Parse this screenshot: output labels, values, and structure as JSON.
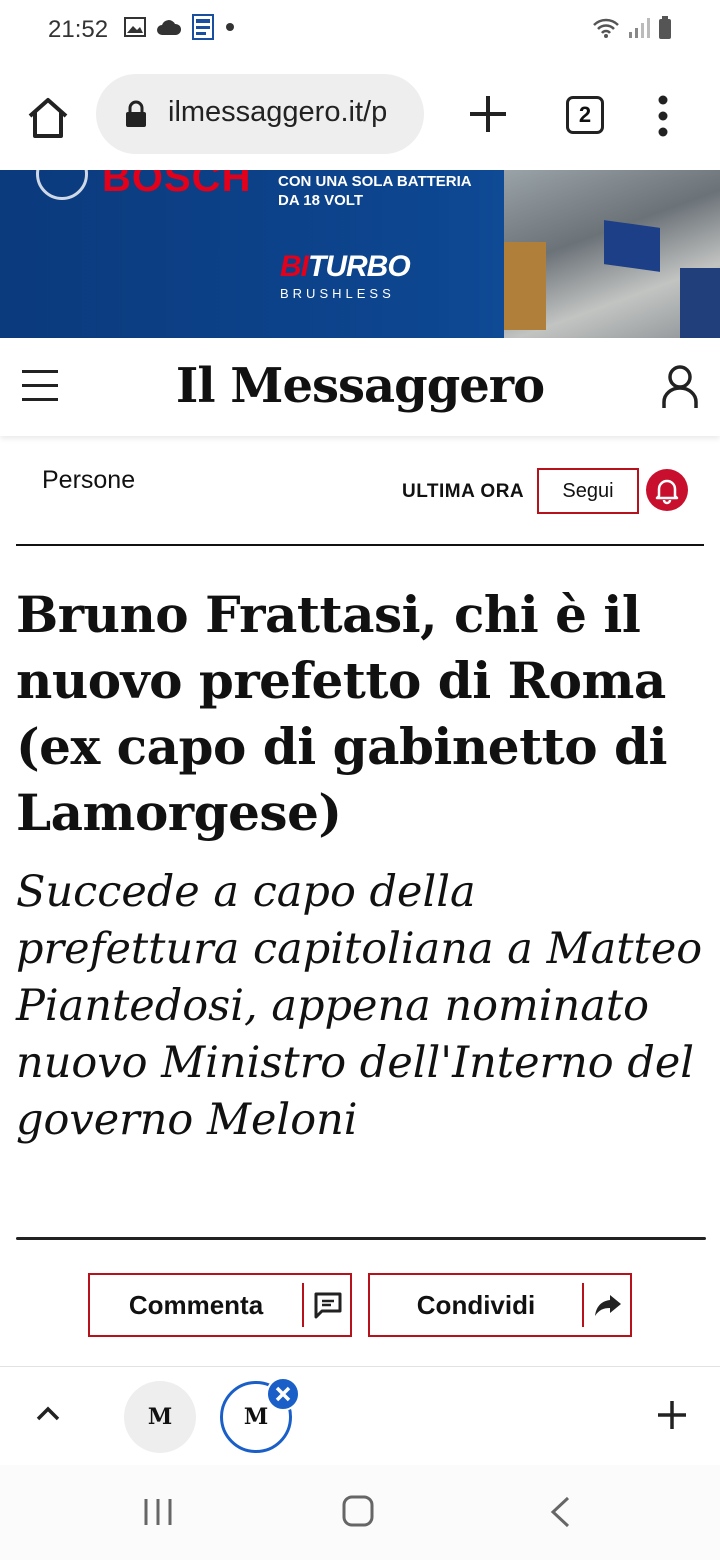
{
  "status_bar": {
    "time": "21:52",
    "left_icons": [
      "image-icon",
      "cloud-icon",
      "document-icon",
      "dot-icon"
    ],
    "right_icons": [
      "wifi-icon",
      "signal-icon",
      "battery-icon"
    ]
  },
  "browser": {
    "url": "ilmessaggero.it/p",
    "tab_count": "2",
    "icons": [
      "home-icon",
      "lock-icon",
      "new-tab-icon",
      "tabs-icon",
      "menu-icon"
    ]
  },
  "ad": {
    "brand": "BOSCH",
    "line1": "CON UNA SOLA BATTERIA",
    "line2": "DA 18 VOLT",
    "product_bi": "BI",
    "product_rest": "TURBO",
    "subtitle": "BRUSHLESS",
    "colors": {
      "background": "#0d4690",
      "accent": "#e2001a"
    }
  },
  "site_header": {
    "masthead": "Il Messaggero"
  },
  "section": {
    "label": "Persone",
    "ultima_ora": "ULTIMA ORA",
    "follow_label": "Segui"
  },
  "article": {
    "headline": "Bruno Frattasi, chi è il nuovo prefetto di Roma (ex capo di gabinetto di Lamorgese)",
    "subheadline": "Succede a capo della prefettura capitoliana a Matteo Piantedosi, appena nominato nuovo Ministro dell'Interno del governo Meloni"
  },
  "actions": {
    "comment_label": "Commenta",
    "share_label": "Condividi",
    "accent": "#b5121b"
  },
  "tab_strip": {
    "tab_logo": "M"
  }
}
